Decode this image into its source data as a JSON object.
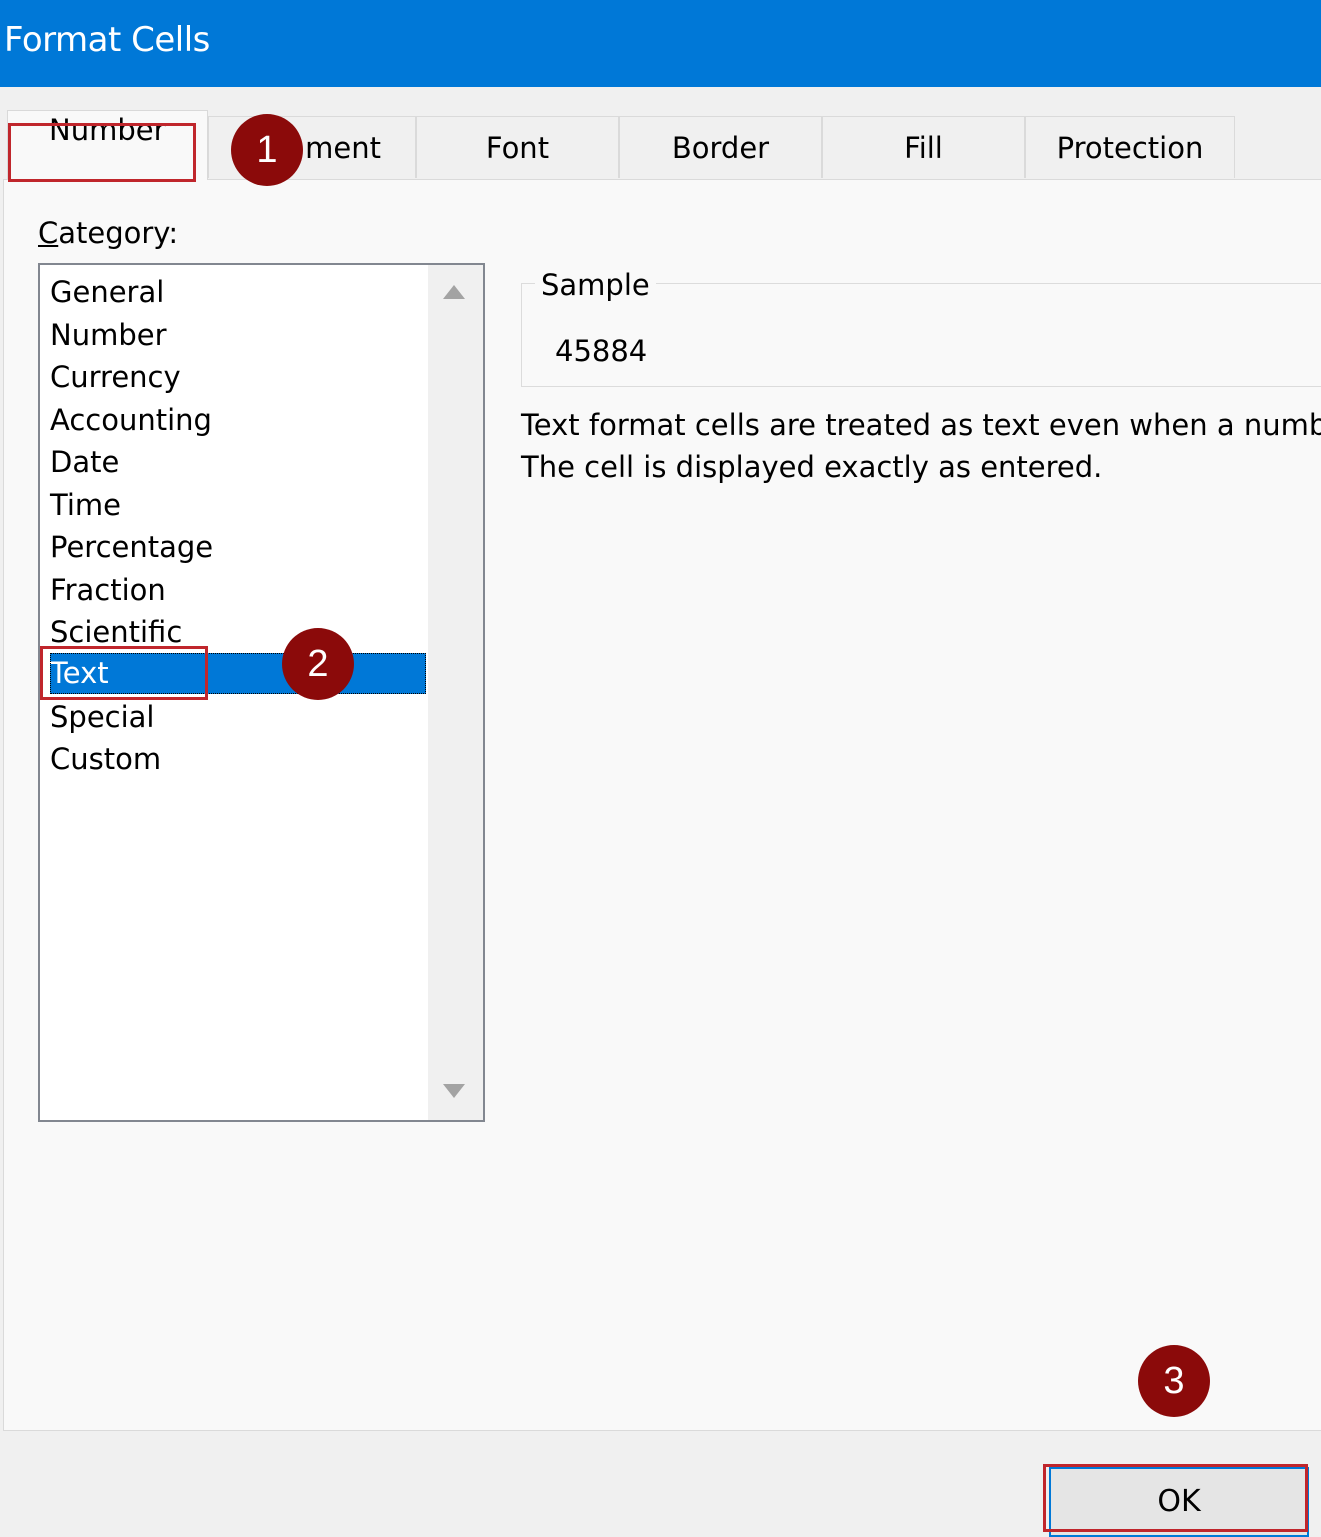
{
  "window": {
    "title": "Format Cells"
  },
  "tabs": [
    {
      "label": "Number",
      "active": true
    },
    {
      "label": "Alignment",
      "visible_label": "ment"
    },
    {
      "label": "Font"
    },
    {
      "label": "Border"
    },
    {
      "label": "Fill"
    },
    {
      "label": "Protection"
    }
  ],
  "category": {
    "label_prefix": "C",
    "label_rest": "ategory:",
    "items": [
      "General",
      "Number",
      "Currency",
      "Accounting",
      "Date",
      "Time",
      "Percentage",
      "Fraction",
      "Scientific",
      "Text",
      "Special",
      "Custom"
    ],
    "selected": "Text"
  },
  "sample": {
    "legend": "Sample",
    "value": "45884"
  },
  "description": {
    "line1": "Text format cells are treated as text even when a numb",
    "line2": "The cell is displayed exactly as entered."
  },
  "buttons": {
    "ok": "OK"
  },
  "annotations": {
    "step1": "1",
    "step2": "2",
    "step3": "3",
    "color": "#8b0a0a",
    "box_color": "#c0262c"
  },
  "colors": {
    "titlebar": "#0078d7",
    "selection": "#0078d7"
  }
}
